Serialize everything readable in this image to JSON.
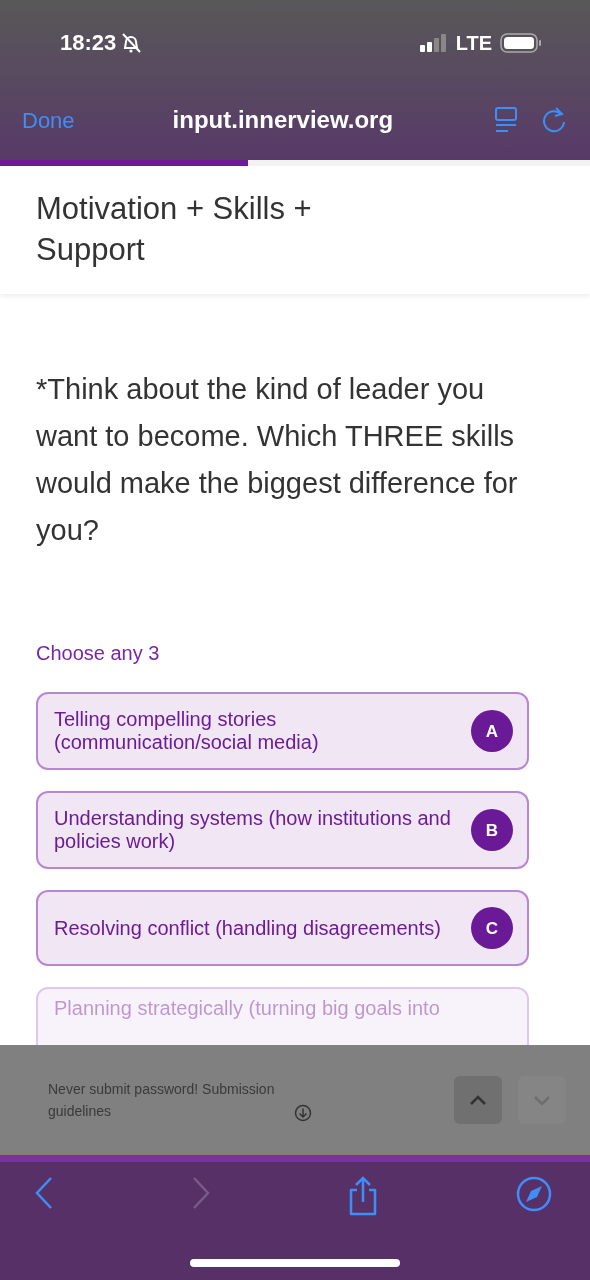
{
  "status_bar": {
    "time": "18:23",
    "silent": true,
    "network": "LTE"
  },
  "browser": {
    "done": "Done",
    "url": "input.innerview.org"
  },
  "progress": {
    "level": 0.42
  },
  "header": {
    "title": "Motivation + Skills + Support"
  },
  "question": {
    "text": "*Think about the kind of leader you want to become. Which THREE skills would make the biggest difference for you?",
    "hint": "Choose any 3"
  },
  "options": [
    {
      "label": "Telling compelling stories (communication/social media)",
      "letter": "A",
      "selected": false
    },
    {
      "label": "Understanding systems (how institutions and policies work)",
      "letter": "B",
      "selected": false
    },
    {
      "label": "Resolving conflict (handling disagreements)",
      "letter": "C",
      "selected": false
    },
    {
      "label": "Planning strategically (turning big goals into",
      "selected": false
    }
  ],
  "footer": {
    "notice": "Never submit password! Submission guidelines",
    "nav": [
      {
        "kind": "up",
        "disabled": false
      },
      {
        "kind": "down",
        "disabled": true
      }
    ]
  },
  "toolbar": {
    "forward_disabled": true
  }
}
